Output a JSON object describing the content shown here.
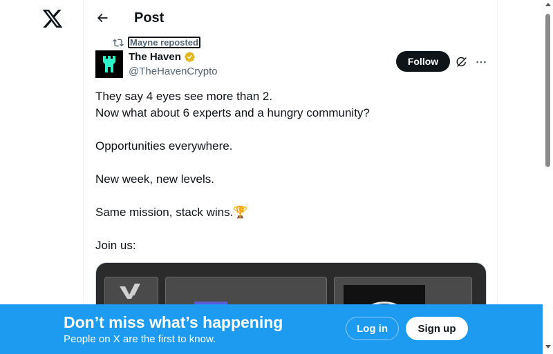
{
  "header": {
    "title": "Post"
  },
  "repost": {
    "label": "Mayne reposted"
  },
  "post": {
    "author": "The Haven",
    "handle": "@TheHavenCrypto",
    "follow_label": "Follow",
    "lines": [
      "They say 4 eyes see more than 2.",
      "Now what about 6 experts and a hungry community?",
      "",
      "Opportunities everywhere.",
      "",
      "New week, new levels.",
      "",
      "Same mission, stack wins.🏆",
      "",
      "Join us:"
    ]
  },
  "banner": {
    "title": "Don’t miss what’s happening",
    "subtitle": "People on X are the first to know.",
    "login_label": "Log in",
    "signup_label": "Sign up"
  },
  "colors": {
    "brand": "#1d9bf0",
    "text": "#0f1419",
    "secondary_text": "#536471",
    "verified": "#e2b719"
  },
  "icons": [
    "x-logo-icon",
    "back-arrow-icon",
    "repost-icon",
    "verified-badge-icon",
    "grok-icon",
    "more-icon"
  ]
}
